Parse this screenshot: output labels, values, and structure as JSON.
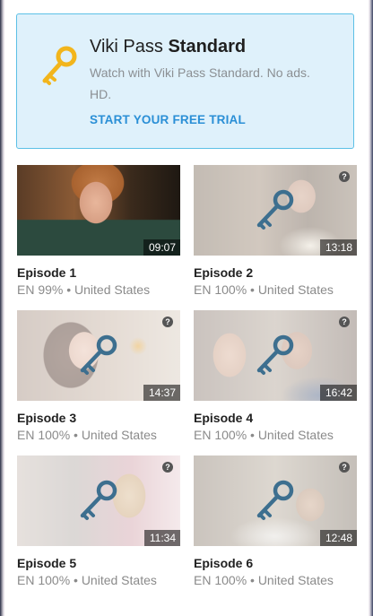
{
  "promo": {
    "icon": "gold-key-icon",
    "title_prefix": "Viki Pass ",
    "title_strong": "Standard",
    "description": "Watch with Viki Pass Standard. No ads. HD.",
    "cta_label": "START YOUR FREE TRIAL",
    "accent_color": "#2a8fd6",
    "background_color": "#dff1fb"
  },
  "episodes": [
    {
      "title": "Episode 1",
      "meta": "EN 99% • United States",
      "duration": "09:07",
      "locked": false
    },
    {
      "title": "Episode 2",
      "meta": "EN 100% • United States",
      "duration": "13:18",
      "locked": true,
      "help_label": "?"
    },
    {
      "title": "Episode 3",
      "meta": "EN 100% • United States",
      "duration": "14:37",
      "locked": true,
      "help_label": "?"
    },
    {
      "title": "Episode 4",
      "meta": "EN 100% • United States",
      "duration": "16:42",
      "locked": true,
      "help_label": "?"
    },
    {
      "title": "Episode 5",
      "meta": "EN 100% • United States",
      "duration": "11:34",
      "locked": true,
      "help_label": "?"
    },
    {
      "title": "Episode 6",
      "meta": "EN 100% • United States",
      "duration": "12:48",
      "locked": true,
      "help_label": "?"
    }
  ],
  "lock_icon": "blue-key-icon",
  "lock_color": "#3d6f8f"
}
